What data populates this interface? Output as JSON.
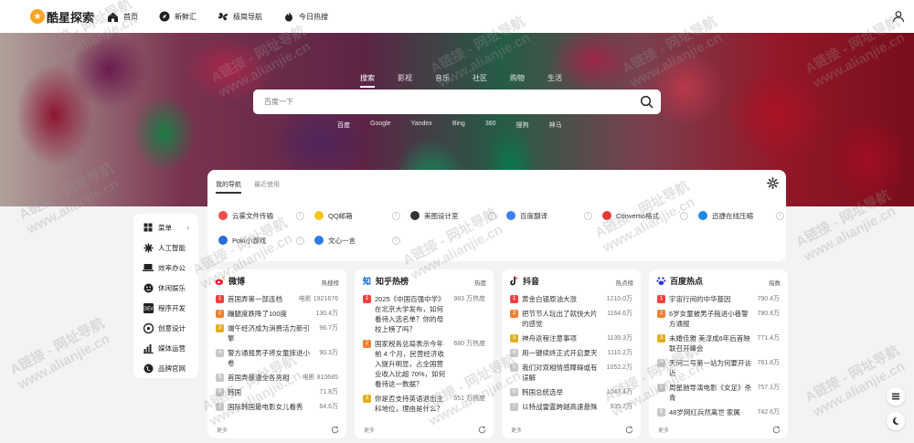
{
  "brand": {
    "name": "酷星探索",
    "mark": "★"
  },
  "nav": [
    {
      "label": "首页",
      "icon": "home-icon"
    },
    {
      "label": "新鲜汇",
      "icon": "compass-icon"
    },
    {
      "label": "极简导航",
      "icon": "fan-icon"
    },
    {
      "label": "今日热搜",
      "icon": "flame-icon"
    }
  ],
  "search": {
    "tabs": [
      "搜索",
      "影视",
      "音乐",
      "社区",
      "购物",
      "生活"
    ],
    "active_tab": 0,
    "placeholder": "百度一下",
    "engines": [
      "百度",
      "Google",
      "Yandex",
      "Bing",
      "360",
      "搜狗",
      "神马"
    ],
    "active_engine": 0
  },
  "quick": {
    "tabs": [
      "我的导航",
      "最近使用"
    ],
    "active_tab": 0,
    "sites": [
      {
        "label": "云雾文件传输",
        "icon": "send-icon",
        "color": "#ee4d4d"
      },
      {
        "label": "QQ邮箱",
        "icon": "qq-icon",
        "color": "#f5c518"
      },
      {
        "label": "美图设计室",
        "icon": "grid-icon",
        "color": "#333333"
      },
      {
        "label": "百度翻译",
        "icon": "translate-icon",
        "color": "#3b82f6"
      },
      {
        "label": "Convertio格式",
        "icon": "convert-icon",
        "color": "#e53935"
      },
      {
        "label": "迅捷在线压缩",
        "icon": "compress-icon",
        "color": "#1e88e5"
      },
      {
        "label": "Poki小游戏",
        "icon": "game-icon",
        "color": "#2a6fd6"
      },
      {
        "label": "文心一言",
        "icon": "ai-icon",
        "color": "#2d7be5"
      }
    ],
    "info_glyph": "i"
  },
  "sidebar": [
    {
      "label": "菜单",
      "icon": "menu-grid-icon",
      "chevron": "›"
    },
    {
      "label": "人工智能",
      "icon": "ai-spark-icon"
    },
    {
      "label": "效率办公",
      "icon": "laptop-icon"
    },
    {
      "label": "休闲娱乐",
      "icon": "smile-icon"
    },
    {
      "label": "程序开发",
      "icon": "code-icon"
    },
    {
      "label": "创意设计",
      "icon": "design-icon"
    },
    {
      "label": "媒体运营",
      "icon": "chart-icon"
    },
    {
      "label": "品牌官网",
      "icon": "globe-icon"
    }
  ],
  "hot": [
    {
      "title": "微博",
      "tag": "热搜榜",
      "icon": "weibo-icon",
      "accent": "#e6162d",
      "items": [
        {
          "rank": "1",
          "text": "首国弄第一部连档",
          "value": "电影 1921676"
        },
        {
          "rank": "2",
          "text": "蹦腿度跌降了100度",
          "value": "130.4万"
        },
        {
          "rank": "3",
          "text": "端午经济成为消费活力新引擎",
          "value": "96.7万"
        },
        {
          "rank": "4",
          "text": "警方通报男子将女童摔进小卷",
          "value": "90.3万"
        },
        {
          "rank": "5",
          "text": "首国弄暴漫全各亮相",
          "value": "电影 810685"
        },
        {
          "rank": "6",
          "text": "韩国",
          "value": "71.8万"
        },
        {
          "rank": "7",
          "text": "国际韩国最电影女儿看秀",
          "value": "64.6万"
        }
      ],
      "more": "更多"
    },
    {
      "title": "知乎热榜",
      "tag": "热度",
      "icon": "zhihu-icon",
      "accent": "#0a66d8",
      "items": [
        {
          "rank": "1",
          "text": "2025《中国百强中学》在北京大学发布，如何看待入选名单？你的母校上榜了吗？",
          "value": "983 万热度"
        },
        {
          "rank": "2",
          "text": "国家税务总局表示今年前 4 个月，民营经济收入提升明显，占全国营业收入比超 70%，如何看待这一数据？",
          "value": "680 万热度"
        },
        {
          "rank": "3",
          "text": "你是否支持英语退出主科地位，理由是什么？",
          "value": "651 万热度"
        }
      ],
      "more": "更多"
    },
    {
      "title": "抖音",
      "tag": "热点榜",
      "icon": "douyin-icon",
      "accent": "#111111",
      "items": [
        {
          "rank": "1",
          "text": "黄金白银原油大涨",
          "value": "1210.0万"
        },
        {
          "rank": "2",
          "text": "把节节人玩出了就快大片的感觉",
          "value": "1164.6万"
        },
        {
          "rank": "3",
          "text": "神舟返程注意事项",
          "value": "1139.3万"
        },
        {
          "rank": "4",
          "text": "用一键续终正式开启夏天",
          "value": "1110.2万"
        },
        {
          "rank": "5",
          "text": "我们对双相情感障碍或有误解",
          "value": "1052.2万"
        },
        {
          "rank": "6",
          "text": "韩国总统选举",
          "value": "1047.4万"
        },
        {
          "rank": "7",
          "text": "以特战雷霆跨越高速悬殊",
          "value": "935.7万"
        }
      ],
      "more": "更多"
    },
    {
      "title": "百度热点",
      "tag": "指数",
      "icon": "baidu-paw-icon",
      "accent": "#2932e1",
      "items": [
        {
          "rank": "1",
          "text": "宇宙行间的中华基因",
          "value": "790.4万"
        },
        {
          "rank": "2",
          "text": "6岁女童被男子拖进小巷警方通报",
          "value": "780.8万"
        },
        {
          "rank": "3",
          "text": "未婚佳雅 美淳成6年后首映联召开峰会",
          "value": "771.4万"
        },
        {
          "rank": "4",
          "text": "天问二号第一站为何要开访近",
          "value": "761.8万"
        },
        {
          "rank": "5",
          "text": "周星驰导演电影《女足》杀青",
          "value": "757.1万"
        },
        {
          "rank": "6",
          "text": "48岁网红兵然离世 家属",
          "value": "742.6万"
        }
      ],
      "more": "更多"
    }
  ],
  "watermark": {
    "line1": "A链接 - 网址导航",
    "line2": "www.alianjie.cn"
  }
}
